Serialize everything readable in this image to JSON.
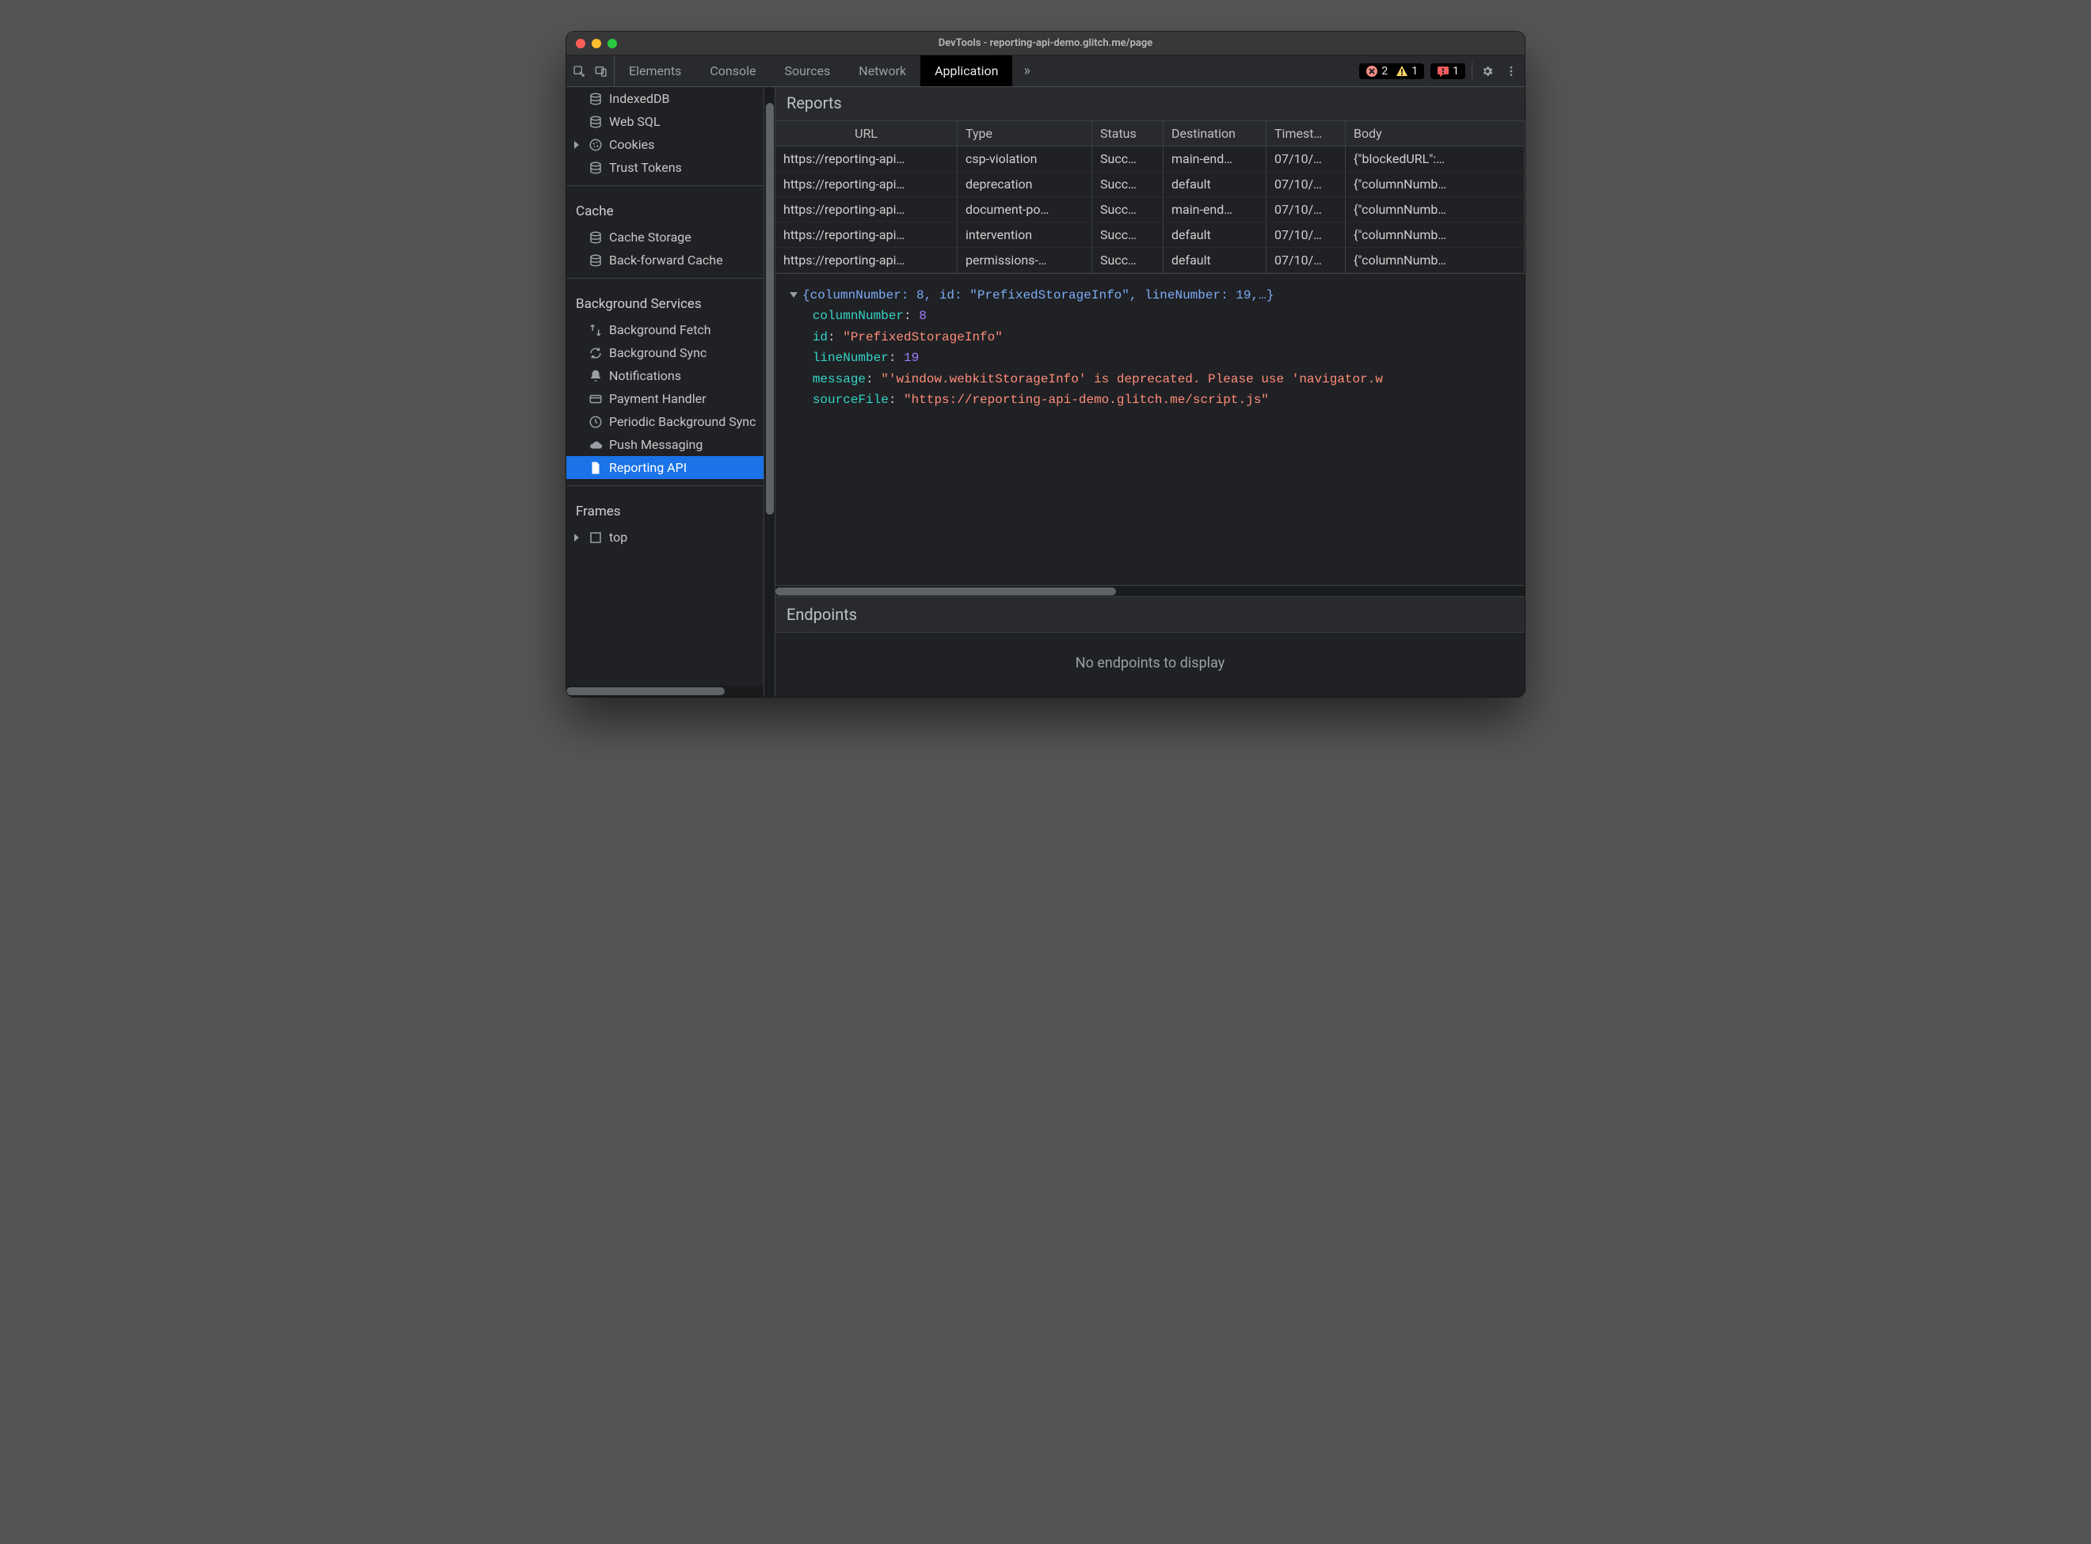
{
  "window": {
    "title": "DevTools - reporting-api-demo.glitch.me/page"
  },
  "toolbar": {
    "tabs": [
      "Elements",
      "Console",
      "Sources",
      "Network",
      "Application"
    ],
    "active_tab": "Application",
    "more_glyph": "»",
    "error_count": "2",
    "warn_count": "1",
    "msg_count": "1"
  },
  "sidebar": {
    "storage_items": [
      {
        "icon": "storage-icon",
        "label": "IndexedDB",
        "expandable": false
      },
      {
        "icon": "storage-icon",
        "label": "Web SQL",
        "expandable": false
      },
      {
        "icon": "cookie-icon",
        "label": "Cookies",
        "expandable": true
      },
      {
        "icon": "storage-icon",
        "label": "Trust Tokens",
        "expandable": false
      }
    ],
    "groups": [
      {
        "label": "Cache",
        "items": [
          {
            "icon": "storage-icon",
            "label": "Cache Storage"
          },
          {
            "icon": "storage-icon",
            "label": "Back-forward Cache"
          }
        ]
      },
      {
        "label": "Background Services",
        "items": [
          {
            "icon": "fetch-icon",
            "label": "Background Fetch"
          },
          {
            "icon": "sync-icon",
            "label": "Background Sync"
          },
          {
            "icon": "bell-icon",
            "label": "Notifications"
          },
          {
            "icon": "card-icon",
            "label": "Payment Handler"
          },
          {
            "icon": "clock-icon",
            "label": "Periodic Background Sync"
          },
          {
            "icon": "cloud-icon",
            "label": "Push Messaging"
          },
          {
            "icon": "file-icon",
            "label": "Reporting API",
            "selected": true
          }
        ]
      },
      {
        "label": "Frames",
        "items": [
          {
            "icon": "frame-icon",
            "label": "top",
            "expandable": true
          }
        ]
      }
    ]
  },
  "reports": {
    "title": "Reports",
    "columns": [
      "URL",
      "Type",
      "Status",
      "Destination",
      "Timest…",
      "Body"
    ],
    "rows": [
      {
        "url": "https://reporting-api…",
        "type": "csp-violation",
        "status": "Succ…",
        "dest": "main-end…",
        "ts": "07/10/…",
        "body": "{\"blockedURL\":…"
      },
      {
        "url": "https://reporting-api…",
        "type": "deprecation",
        "status": "Succ…",
        "dest": "default",
        "ts": "07/10/…",
        "body": "{\"columnNumb…"
      },
      {
        "url": "https://reporting-api…",
        "type": "document-po…",
        "status": "Succ…",
        "dest": "main-end…",
        "ts": "07/10/…",
        "body": "{\"columnNumb…"
      },
      {
        "url": "https://reporting-api…",
        "type": "intervention",
        "status": "Succ…",
        "dest": "default",
        "ts": "07/10/…",
        "body": "{\"columnNumb…"
      },
      {
        "url": "https://reporting-api…",
        "type": "permissions-…",
        "status": "Succ…",
        "dest": "default",
        "ts": "07/10/…",
        "body": "{\"columnNumb…"
      }
    ]
  },
  "detail": {
    "summary": "{columnNumber: 8, id: \"PrefixedStorageInfo\", lineNumber: 19,…}",
    "props": {
      "columnNumber": "8",
      "id": "\"PrefixedStorageInfo\"",
      "lineNumber": "19",
      "message": "\"'window.webkitStorageInfo' is deprecated. Please use 'navigator.w",
      "sourceFile": "\"https://reporting-api-demo.glitch.me/script.js\""
    }
  },
  "endpoints": {
    "title": "Endpoints",
    "empty": "No endpoints to display"
  }
}
